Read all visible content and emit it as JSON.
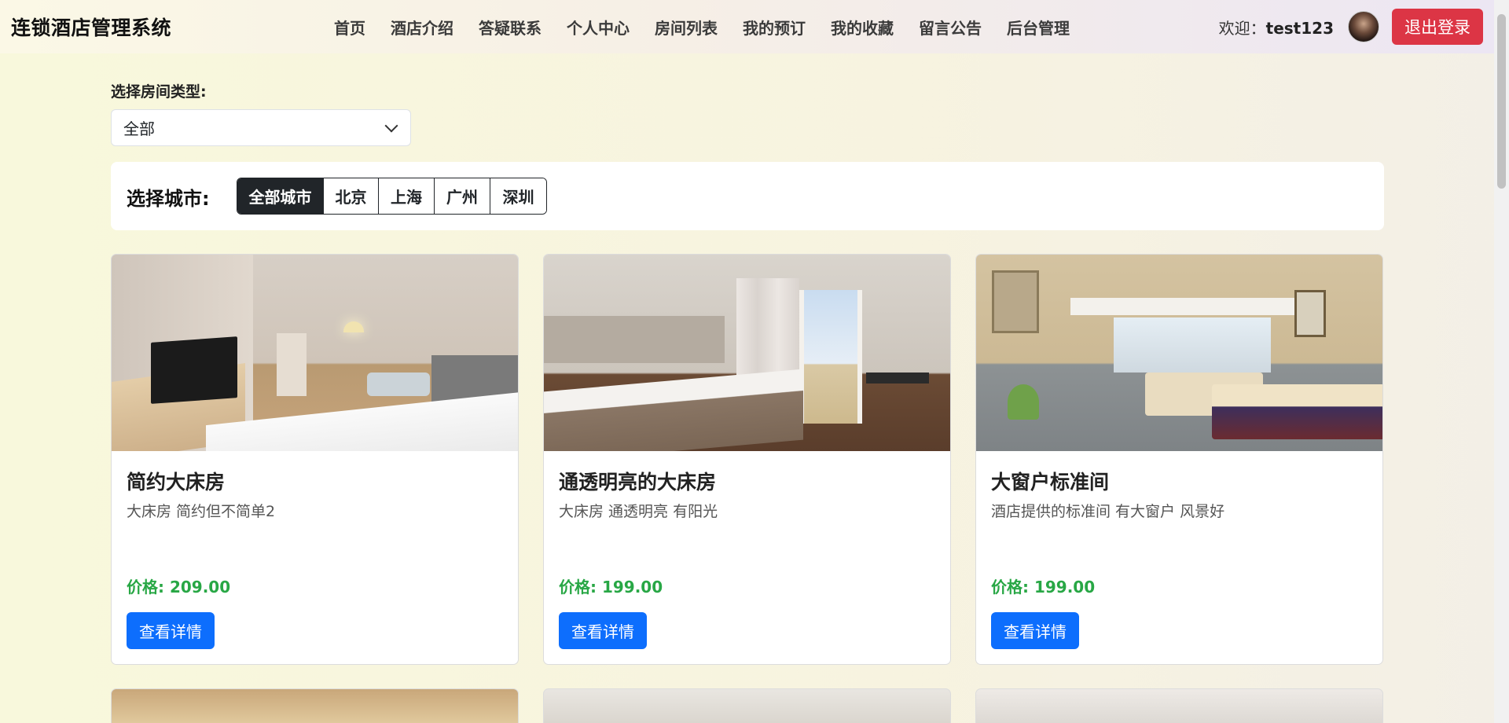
{
  "navbar": {
    "brand": "连锁酒店管理系统",
    "links": [
      "首页",
      "酒店介绍",
      "答疑联系",
      "个人中心",
      "房间列表",
      "我的预订",
      "我的收藏",
      "留言公告",
      "后台管理"
    ],
    "welcome_prefix": "欢迎：",
    "username": "test123",
    "logout_label": "退出登录"
  },
  "room_type": {
    "label": "选择房间类型:",
    "selected": "全部"
  },
  "city_filter": {
    "label": "选择城市:",
    "options": [
      "全部城市",
      "北京",
      "上海",
      "广州",
      "深圳"
    ],
    "active": "全部城市"
  },
  "rooms": [
    {
      "title": "简约大床房",
      "description": "大床房 简约但不简单2",
      "price": "价格: 209.00",
      "button": "查看详情"
    },
    {
      "title": "通透明亮的大床房",
      "description": "大床房 通透明亮 有阳光",
      "price": "价格: 199.00",
      "button": "查看详情"
    },
    {
      "title": "大窗户标准间",
      "description": "酒店提供的标准间 有大窗户 风景好",
      "price": "价格: 199.00",
      "button": "查看详情"
    }
  ],
  "colors": {
    "logout": "#dc3545",
    "primary_button": "#0d6efd",
    "price": "#28a745",
    "active_city": "#212529"
  }
}
